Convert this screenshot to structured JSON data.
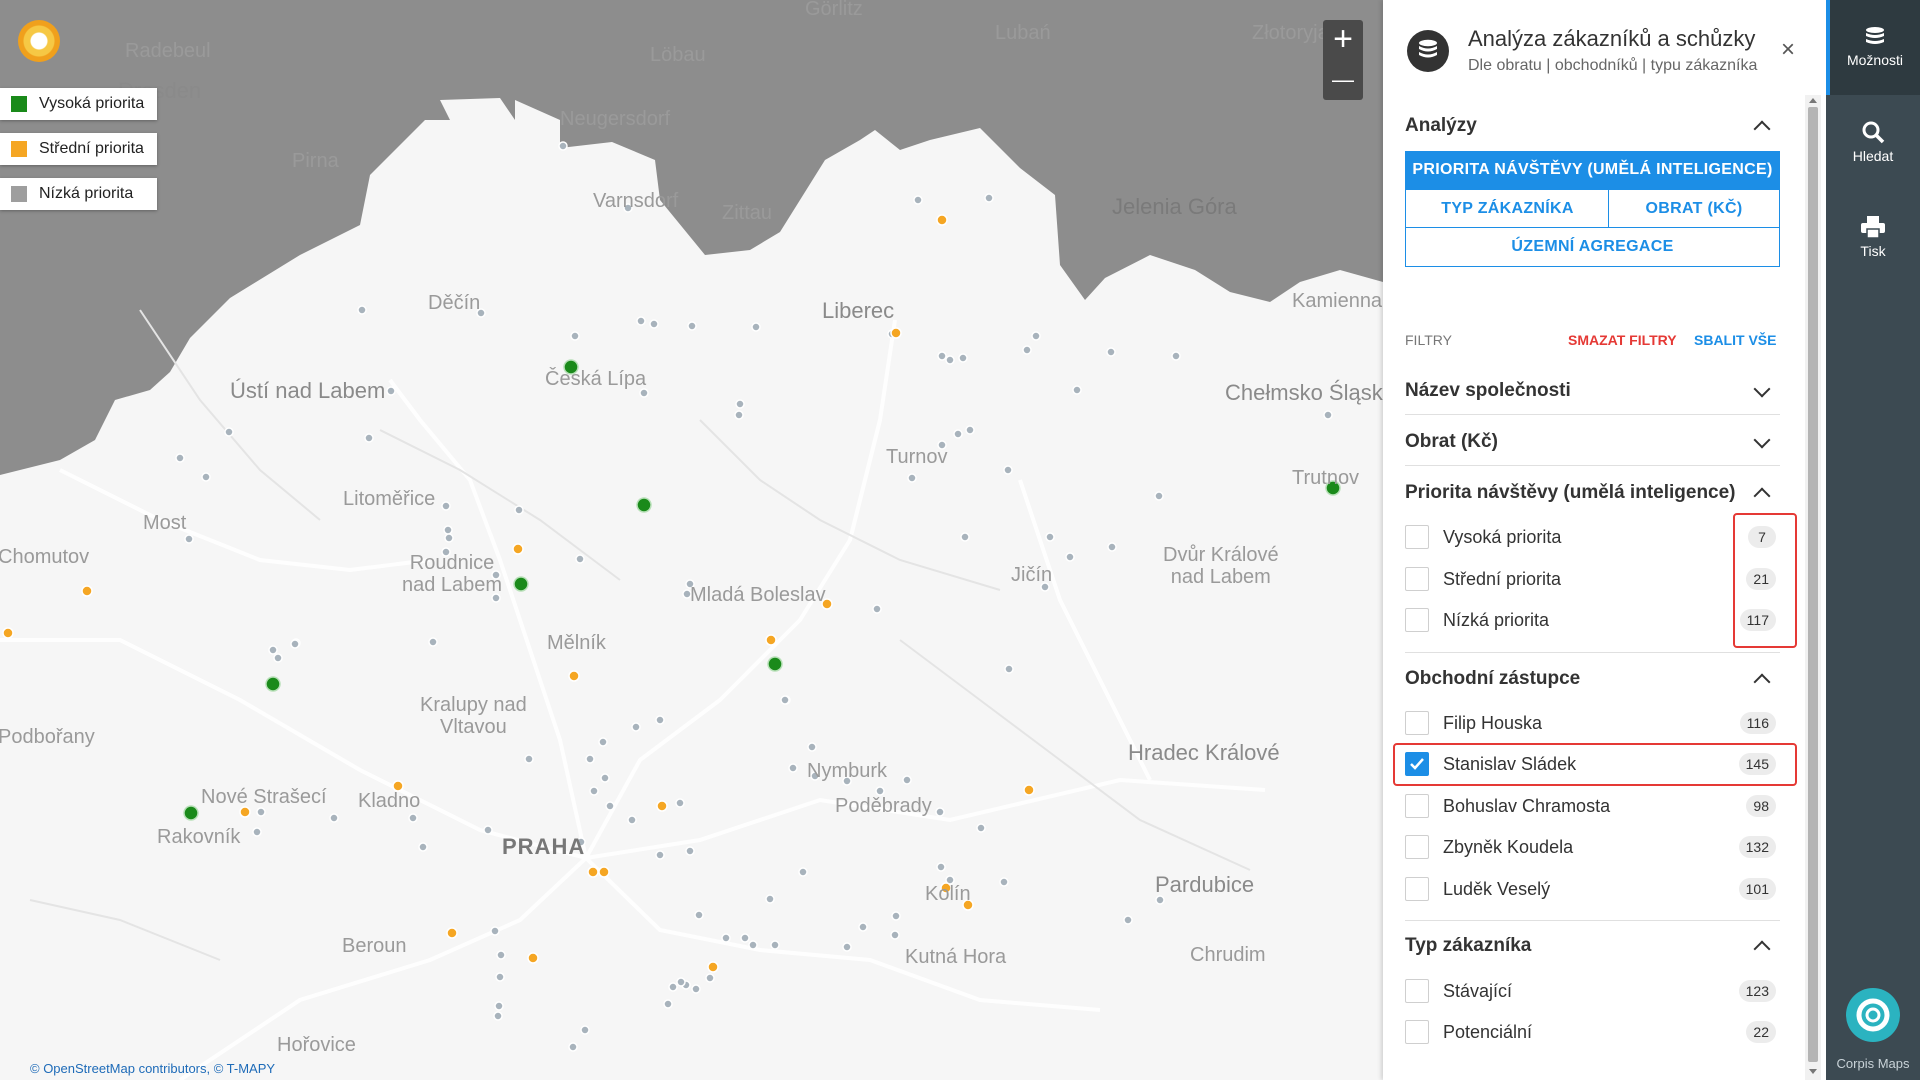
{
  "map": {
    "legend": [
      {
        "label": "Vysoká priorita",
        "color": "#1a8a1a"
      },
      {
        "label": "Střední priorita",
        "color": "#f5a623"
      },
      {
        "label": "Nízká priorita",
        "color": "#9e9e9e"
      }
    ],
    "zoom_in": "+",
    "zoom_out": "—",
    "attribution": "© OpenStreetMap contributors, © T-MAPY",
    "places": {
      "radebeul": "Radebeul",
      "dresden": "Dresden",
      "pirna": "Pirna",
      "neugersdorf": "Neugersdorf",
      "varnsdorf": "Varnsdorf",
      "zittau": "Zittau",
      "gorlitz": "Görlitz",
      "luban": "Lubań",
      "lobau": "Löbau",
      "zlotoryja": "Złotoryja",
      "jelenia": "Jelenia Góra",
      "kamienna": "Kamienna Góra",
      "decin": "Děčín",
      "usti": "Ústí nad Labem",
      "ceska_lipa": "Česká Lípa",
      "liberec": "Liberec",
      "chelmsko": "Chełmsko Śląskie",
      "most": "Most",
      "litomerice": "Litoměřice",
      "chomutov": "Chomutov",
      "turnov": "Turnov",
      "trutnov": "Trutnov",
      "roudnice": "Roudnice\nnad Labem",
      "mlada": "Mladá Boleslav",
      "jicin": "Jičín",
      "dvur": "Dvůr Králové\nnad Labem",
      "melnik": "Mělník",
      "kralupy": "Kralupy nad\nVltavou",
      "podborany": "Podbořany",
      "hradec": "Hradec Králové",
      "nymburk": "Nymburk",
      "podebrady": "Poděbrady",
      "nove_straseci": "Nové Strašecí",
      "kladno": "Kladno",
      "rakovnik": "Rakovník",
      "praha": "PRAHA",
      "pardubice": "Pardubice",
      "kolin": "Kolín",
      "beroun": "Beroun",
      "chrudim": "Chrudim",
      "kutna": "Kutná Hora",
      "horovice": "Hořovice"
    }
  },
  "panel": {
    "title": "Analýza zákazníků a schůzky",
    "subtitle": "Dle obratu | obchodníků | typu zákazníka",
    "close": "×",
    "analyses": {
      "title": "Analýzy",
      "buttons": {
        "priority": "PRIORITA NÁVŠTĚVY (UMĚLÁ INTELIGENCE)",
        "type": "TYP ZÁKAZNÍKA",
        "revenue": "OBRAT (KČ)",
        "regional": "ÚZEMNÍ AGREGACE"
      }
    },
    "filters_label": "FILTRY",
    "clear_filters": "SMAZAT FILTRY",
    "collapse_all": "SBALIT VŠE",
    "company_name": "Název společnosti",
    "revenue": "Obrat (Kč)",
    "priority": {
      "title": "Priorita návštěvy (umělá inteligence)",
      "items": [
        {
          "label": "Vysoká priorita",
          "count": "7",
          "checked": false
        },
        {
          "label": "Střední priorita",
          "count": "21",
          "checked": false
        },
        {
          "label": "Nízká priorita",
          "count": "117",
          "checked": false
        }
      ]
    },
    "reps": {
      "title": "Obchodní zástupce",
      "items": [
        {
          "label": "Filip Houska",
          "count": "116",
          "checked": false
        },
        {
          "label": "Stanislav Sládek",
          "count": "145",
          "checked": true
        },
        {
          "label": "Bohuslav Chramosta",
          "count": "98",
          "checked": false
        },
        {
          "label": "Zbyněk Koudela",
          "count": "132",
          "checked": false
        },
        {
          "label": "Luděk Veselý",
          "count": "101",
          "checked": false
        }
      ]
    },
    "customer_type": {
      "title": "Typ zákazníka",
      "items": [
        {
          "label": "Stávající",
          "count": "123",
          "checked": false
        },
        {
          "label": "Potenciální",
          "count": "22",
          "checked": false
        }
      ]
    }
  },
  "rail": {
    "options": "Možnosti",
    "search": "Hledat",
    "print": "Tisk",
    "brand": "Corpis Maps"
  }
}
